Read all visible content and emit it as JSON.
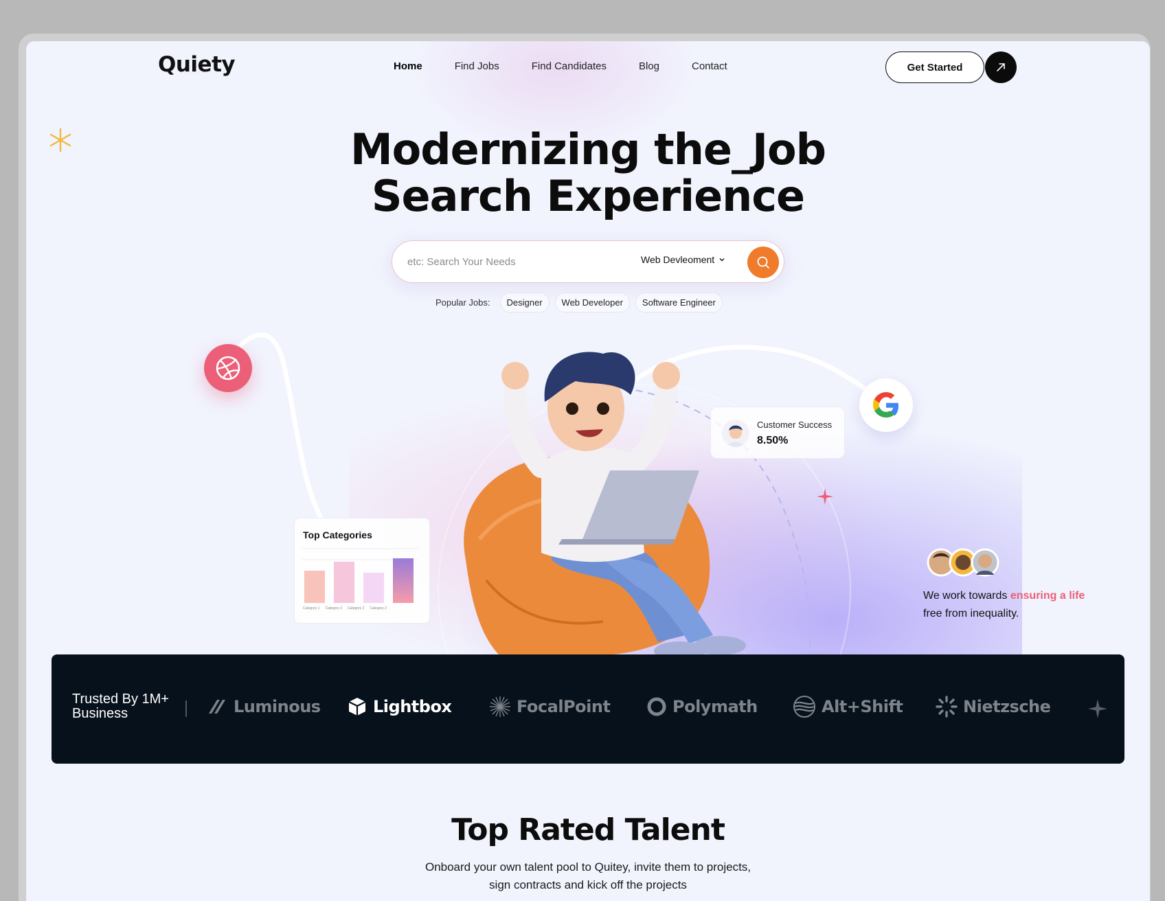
{
  "brand": {
    "name": "Quiety"
  },
  "nav": {
    "items": [
      {
        "label": "Home",
        "active": true
      },
      {
        "label": "Find Jobs"
      },
      {
        "label": "Find Candidates"
      },
      {
        "label": "Blog"
      },
      {
        "label": "Contact"
      }
    ],
    "cta_label": "Get Started"
  },
  "hero": {
    "title_line1": "Modernizing the_Job",
    "title_line2": "Search Experience",
    "search": {
      "placeholder": "etc: Search Your Needs",
      "category": "Web Devleoment"
    },
    "popular_label": "Popular Jobs:",
    "popular_jobs": [
      "Designer",
      "Web Developer",
      "Software Engineer"
    ]
  },
  "customer_success": {
    "title": "Customer Success",
    "value": "8.50%"
  },
  "top_categories": {
    "title": "Top Categories",
    "legend": [
      "Category 1",
      "Category 2",
      "Category 2",
      "Category 2"
    ]
  },
  "mission": {
    "text_before": "We work towards ",
    "highlight": "ensuring a life",
    "text_after": "free from inequality."
  },
  "trusted": {
    "title": "Trusted By 1M+ Business",
    "brands": [
      "Luminous",
      "Lightbox",
      "FocalPoint",
      "Polymath",
      "Alt+Shift",
      "Nietzsche"
    ]
  },
  "talent": {
    "title": "Top Rated Talent",
    "subtitle": "Onboard your own talent pool to Quitey, invite them to projects, sign contracts and kick off the projects"
  },
  "colors": {
    "accent_orange": "#f07b2a",
    "accent_pink": "#ec5f78",
    "band_bg": "#07111b",
    "page_bg": "#f1f3fd"
  },
  "icons": [
    "arrow-up-right-icon",
    "search-icon",
    "chevron-down-icon",
    "asterisk-icon",
    "dribbble-icon",
    "google-icon",
    "sparkle-icon"
  ]
}
